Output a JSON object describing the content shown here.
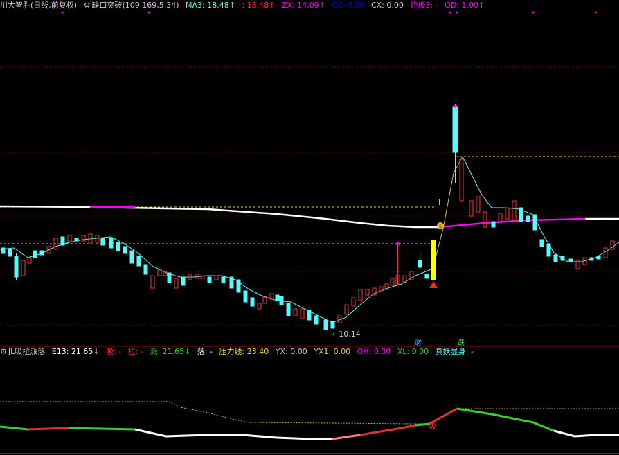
{
  "main_panel": {
    "stock_name": "川大智胜",
    "period": "(日线,前复权)",
    "indicator_name": "缺口突破",
    "indicator_params": "(109,169,5,34)",
    "ma3": "MA3: 18.48↑",
    "ma3_b": ": 18.48↑",
    "zx": "ZX: 14.09↑",
    "cc": "CC: 0.00",
    "cx": "CX: 0.00",
    "zhaban": "炸板3: -",
    "qd": "QD: 1.00↑",
    "low_price_label": "←10.14",
    "marker_cai": "财",
    "marker_die": "跌",
    "marker_i": "I"
  },
  "sub_panel": {
    "name": "JL吸拉派落",
    "e13": "E13: 21.65↓",
    "xi": "吸: -",
    "la": "拉: -",
    "pai": "派: 21.65↓",
    "luo": "落: -",
    "yali": "压力线: 23.40",
    "yx": "YX: 0.00",
    "yx1": "YX1: 0.00",
    "qh": "QH: 0.00",
    "xl": "XL: 0.00",
    "zhenyao": "真妖显身: -",
    "signal_char": "吸"
  },
  "colors": {
    "up": "#ff3232",
    "down": "#54fcfc",
    "ma": "#54fcfc",
    "zx_line": "#ffffff",
    "magenta": "#ff00ff",
    "yellow": "#ffff00",
    "bg": "#000000"
  },
  "chart_data": {
    "type": "candlestick",
    "ma3_last": 18.48,
    "zx_last": 14.09,
    "low_marked": 10.14,
    "e13_last": 21.65,
    "pressure_line": 23.4
  }
}
